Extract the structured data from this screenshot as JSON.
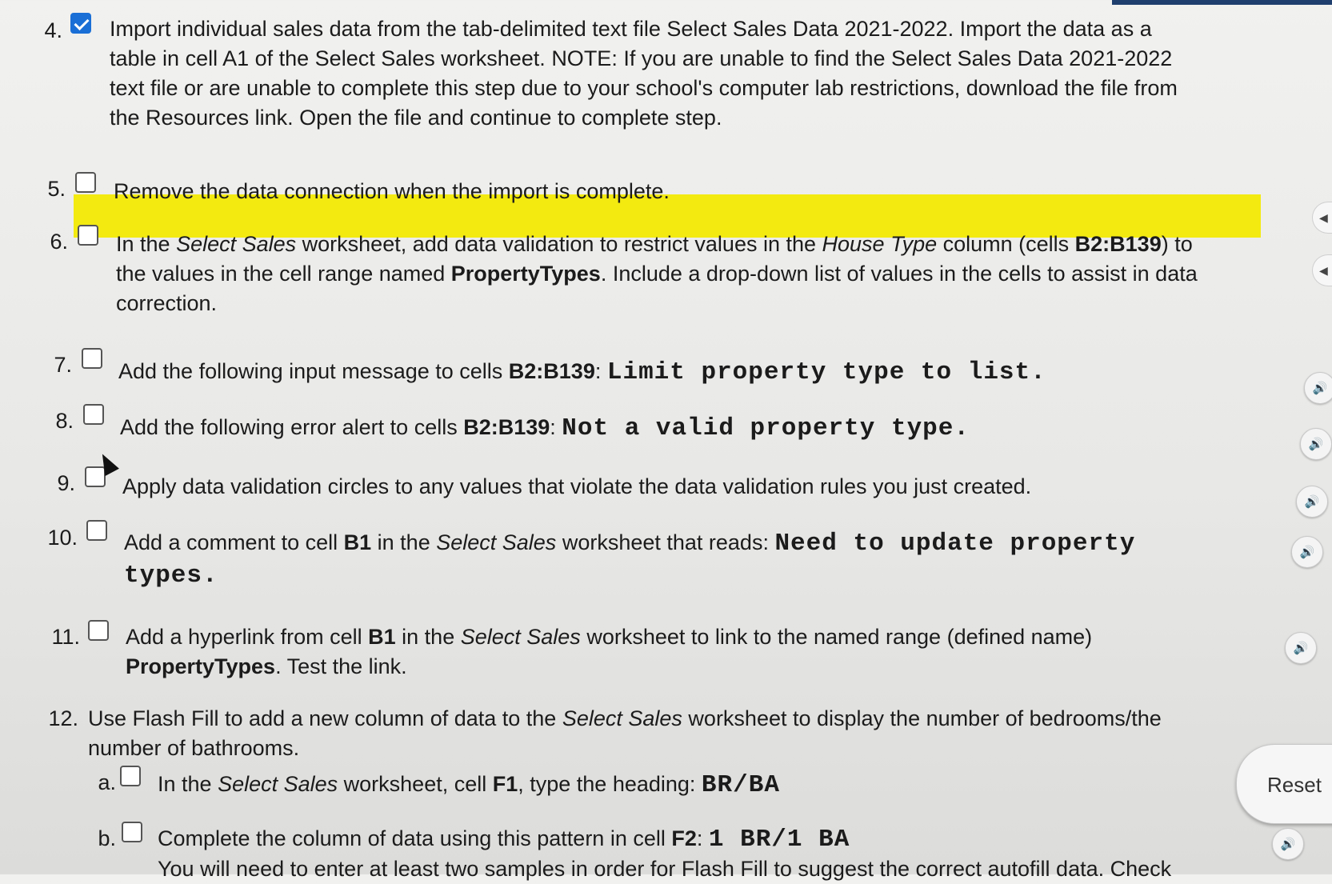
{
  "steps": {
    "s4": {
      "num": "4.",
      "checked": true,
      "lines": [
        "Import individual sales data from the tab-delimited text file Select Sales Data 2021-2022. Import the data as a",
        "table in cell A1 of the Select Sales worksheet. NOTE: If you are unable to find the Select Sales Data 2021-2022",
        "text file or are unable to complete this step due to your school's computer lab restrictions, download the file from",
        "the Resources link. Open the file and continue to complete step."
      ]
    },
    "s5": {
      "num": "5.",
      "checked": false,
      "text": "Remove the data connection when the import is complete."
    },
    "s6": {
      "num": "6.",
      "checked": false,
      "l1a": "In the ",
      "l1b": "Select Sales",
      "l1c": " worksheet, add data validation to restrict values in the ",
      "l1d": "House Type",
      "l1e": " column (cells ",
      "l1f": "B2:B139",
      "l1g": ") to",
      "l2a": "the values in the cell range named ",
      "l2b": "PropertyTypes",
      "l2c": ". Include a drop-down list of values in the cells to assist in data",
      "l3": "correction."
    },
    "s7": {
      "num": "7.",
      "checked": false,
      "a": "Add the following input message to cells ",
      "b": "B2:B139",
      "c": ": ",
      "mono": "Limit property type to list."
    },
    "s8": {
      "num": "8.",
      "checked": false,
      "a": "Add the following error alert to cells ",
      "b": "B2:B139",
      "c": ": ",
      "mono": "Not a valid property type."
    },
    "s9": {
      "num": "9.",
      "checked": false,
      "text": "Apply data validation circles to any values that violate the data validation rules you just created."
    },
    "s10": {
      "num": "10.",
      "checked": false,
      "a": "Add a comment to cell ",
      "b": "B1",
      "c": " in the ",
      "d": "Select Sales",
      "e": " worksheet that reads: ",
      "mono1": "Need to update property",
      "mono2": "types."
    },
    "s11": {
      "num": "11.",
      "checked": false,
      "a": "Add a hyperlink from cell ",
      "b": "B1",
      "c": " in the ",
      "d": "Select Sales",
      "e": " worksheet to link to the named range (defined name)",
      "f": "PropertyTypes",
      "g": ". Test the link."
    },
    "s12": {
      "num": "12.",
      "a": "Use Flash Fill to add a new column of data to the ",
      "b": "Select Sales",
      "c": " worksheet to display the number of bedrooms/the",
      "l2": "number of bathrooms.",
      "subA": {
        "label": "a.",
        "checked": false,
        "a": "In the ",
        "b": "Select Sales",
        "c": " worksheet, cell ",
        "d": "F1",
        "e": ", type the heading: ",
        "mono": "BR/BA"
      },
      "subB": {
        "label": "b.",
        "checked": false,
        "a": "Complete the column of data using this pattern in cell ",
        "b": "F2",
        "c": ": ",
        "mono": "1 BR/1 BA",
        "l2": "You will need to enter at least two samples in order for Flash Fill to suggest the correct autofill data. Check"
      }
    }
  },
  "buttons": {
    "reset": "Reset",
    "audio_icon": "speaker-icon",
    "side_icon": "chevron-left-icon"
  },
  "colors": {
    "highlight": "#f3ea10",
    "checkbox_checked": "#1a6fd6"
  }
}
